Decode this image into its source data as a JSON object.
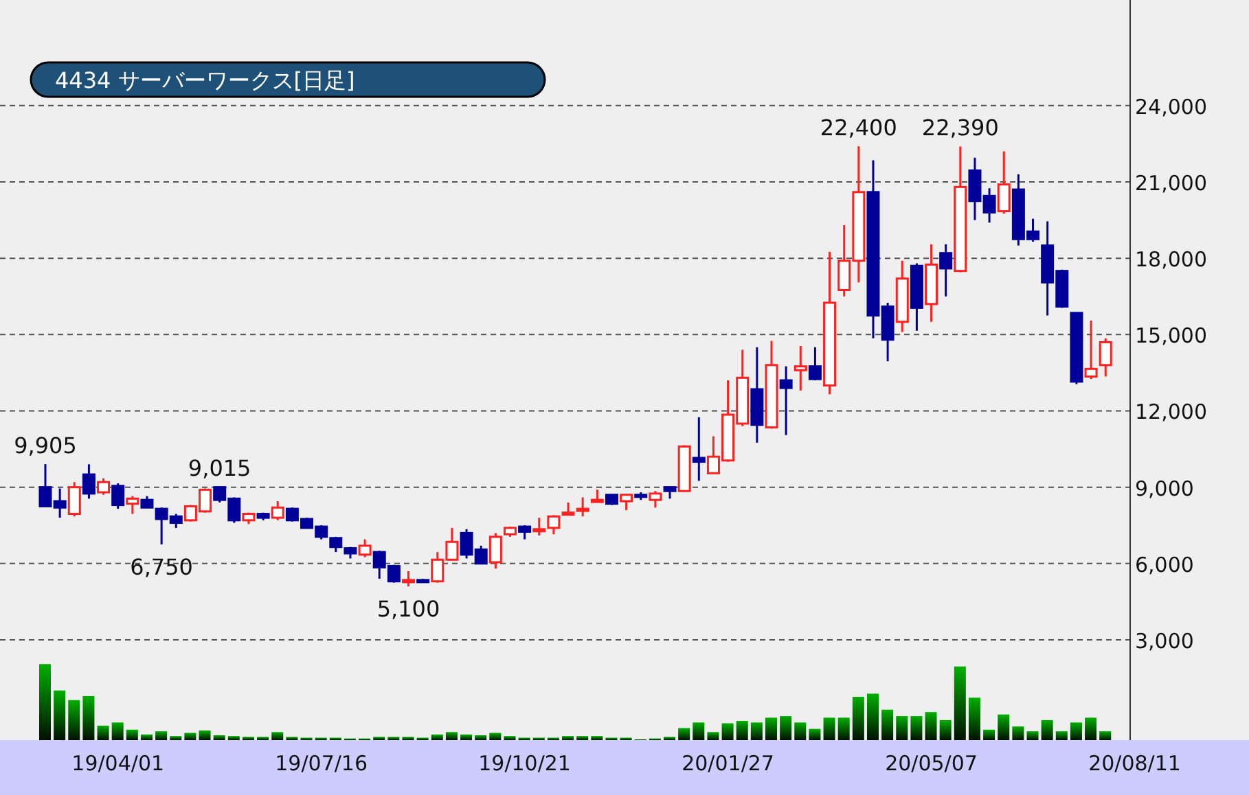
{
  "title": "4434 サーバーワークス[日足]",
  "chart_data": {
    "type": "candlestick",
    "categories": [
      null,
      null,
      null,
      null,
      null,
      "19/04/01",
      null,
      null,
      null,
      null,
      null,
      null,
      null,
      null,
      null,
      null,
      null,
      null,
      null,
      "19/07/16",
      null,
      null,
      null,
      null,
      null,
      null,
      null,
      null,
      null,
      null,
      null,
      null,
      null,
      "19/10/21",
      null,
      null,
      null,
      null,
      null,
      null,
      null,
      null,
      null,
      null,
      null,
      null,
      null,
      "20/01/27",
      null,
      null,
      null,
      null,
      null,
      null,
      null,
      null,
      null,
      null,
      null,
      null,
      null,
      "20/05/07",
      null,
      null,
      null,
      null,
      null,
      null,
      null,
      null,
      null,
      null,
      null,
      null,
      null,
      "20/08/11"
    ],
    "ohlc": [
      [
        9000,
        9905,
        8250,
        8250
      ],
      [
        8450,
        8950,
        7800,
        8200
      ],
      [
        7950,
        9200,
        7850,
        9000
      ],
      [
        9500,
        9900,
        8550,
        8750
      ],
      [
        8800,
        9350,
        8700,
        9200
      ],
      [
        9050,
        9150,
        8150,
        8300
      ],
      [
        8350,
        8650,
        7950,
        8550
      ],
      [
        8500,
        8650,
        8200,
        8200
      ],
      [
        8150,
        8200,
        6750,
        7750
      ],
      [
        7850,
        7950,
        7400,
        7600
      ],
      [
        7700,
        8300,
        7650,
        8250
      ],
      [
        8050,
        8950,
        8000,
        8900
      ],
      [
        9000,
        9015,
        8400,
        8500
      ],
      [
        8550,
        8600,
        7600,
        7700
      ],
      [
        7700,
        8000,
        7550,
        7950
      ],
      [
        7950,
        8000,
        7700,
        7800
      ],
      [
        7800,
        8450,
        7700,
        8200
      ],
      [
        8150,
        8200,
        7650,
        7700
      ],
      [
        7750,
        7800,
        7400,
        7400
      ],
      [
        7450,
        7500,
        6950,
        7050
      ],
      [
        7000,
        7050,
        6450,
        6650
      ],
      [
        6600,
        6650,
        6200,
        6400
      ],
      [
        6350,
        6950,
        6250,
        6700
      ],
      [
        6450,
        6500,
        5400,
        5850
      ],
      [
        5900,
        5950,
        5250,
        5300
      ],
      [
        5300,
        5700,
        5100,
        5350
      ],
      [
        5350,
        5400,
        5250,
        5300
      ],
      [
        5300,
        6450,
        5250,
        6150
      ],
      [
        6150,
        7400,
        6150,
        6850
      ],
      [
        7200,
        7350,
        6200,
        6350
      ],
      [
        6550,
        6700,
        6000,
        6000
      ],
      [
        6050,
        7200,
        5800,
        7050
      ],
      [
        7150,
        7450,
        7050,
        7400
      ],
      [
        7450,
        7500,
        6950,
        7250
      ],
      [
        7300,
        7800,
        7100,
        7350
      ],
      [
        7400,
        7900,
        7150,
        7850
      ],
      [
        7950,
        8400,
        7950,
        8000
      ],
      [
        8150,
        8600,
        7850,
        8150
      ],
      [
        8500,
        8900,
        8450,
        8500
      ],
      [
        8700,
        8700,
        8300,
        8350
      ],
      [
        8450,
        8700,
        8100,
        8700
      ],
      [
        8700,
        8800,
        8500,
        8650
      ],
      [
        8500,
        8850,
        8200,
        8750
      ],
      [
        9000,
        9000,
        8550,
        8850
      ],
      [
        8850,
        10650,
        8850,
        10600
      ],
      [
        10150,
        11750,
        9250,
        10000
      ],
      [
        9550,
        11000,
        9550,
        10200
      ],
      [
        10050,
        13200,
        10000,
        11850
      ],
      [
        11500,
        14400,
        11400,
        13300
      ],
      [
        12850,
        14500,
        10750,
        11450
      ],
      [
        11350,
        14750,
        11300,
        13800
      ],
      [
        13200,
        13750,
        11050,
        12900
      ],
      [
        13600,
        14550,
        12800,
        13750
      ],
      [
        13750,
        14500,
        13200,
        13250
      ],
      [
        13000,
        18250,
        12650,
        16250
      ],
      [
        16750,
        19300,
        16500,
        17900
      ],
      [
        17900,
        22400,
        17050,
        20600
      ],
      [
        20600,
        21850,
        14850,
        15750
      ],
      [
        16100,
        16250,
        13950,
        14800
      ],
      [
        15500,
        17900,
        15100,
        17200
      ],
      [
        17700,
        17800,
        15150,
        16050
      ],
      [
        16200,
        18550,
        15500,
        17750
      ],
      [
        18200,
        18550,
        16500,
        17600
      ],
      [
        17500,
        22390,
        17450,
        20800
      ],
      [
        21450,
        21950,
        19500,
        20250
      ],
      [
        20450,
        20750,
        19400,
        19800
      ],
      [
        19850,
        22200,
        19750,
        20900
      ],
      [
        20700,
        21300,
        18500,
        18750
      ],
      [
        19050,
        19550,
        18650,
        18750
      ],
      [
        18500,
        19450,
        15750,
        17050
      ],
      [
        17500,
        17550,
        16050,
        16100
      ],
      [
        15850,
        15850,
        13050,
        13150
      ],
      [
        13350,
        15550,
        13250,
        13650
      ],
      [
        13800,
        14850,
        13350,
        14700
      ],
      null,
      null
    ],
    "ylim": [
      -940,
      28150
    ],
    "grid": true,
    "yticks": [
      {
        "value": 24000,
        "label": "24,000"
      },
      {
        "value": 21000,
        "label": "21,000"
      },
      {
        "value": 18000,
        "label": "18,000"
      },
      {
        "value": 15000,
        "label": "15,000"
      },
      {
        "value": 12000,
        "label": "12,000"
      },
      {
        "value": 9000,
        "label": "9,000"
      },
      {
        "value": 6000,
        "label": "6,000"
      },
      {
        "value": 3000,
        "label": "3,000"
      }
    ],
    "annotations": [
      "9,905",
      "6,750",
      "9,015",
      "5,100",
      "22,400",
      "22,390"
    ]
  }
}
